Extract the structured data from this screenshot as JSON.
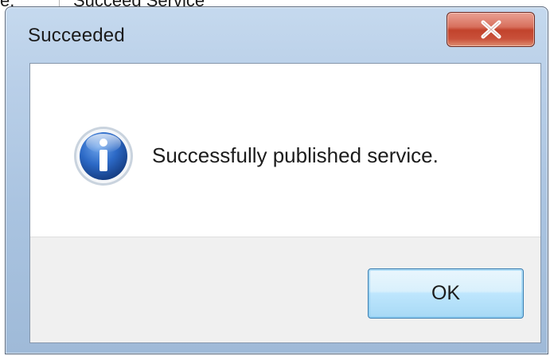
{
  "background": {
    "left_text": "e.",
    "right_text": "Succeed Service"
  },
  "dialog": {
    "title": "Succeeded",
    "close_glyph": "X",
    "message": "Successfully published service.",
    "ok_label": "OK",
    "icon": "info-icon"
  },
  "colors": {
    "close_button_red": "#c2432c",
    "info_icon_blue": "#1d5fb8",
    "ok_button_border": "#3c7fb1"
  }
}
